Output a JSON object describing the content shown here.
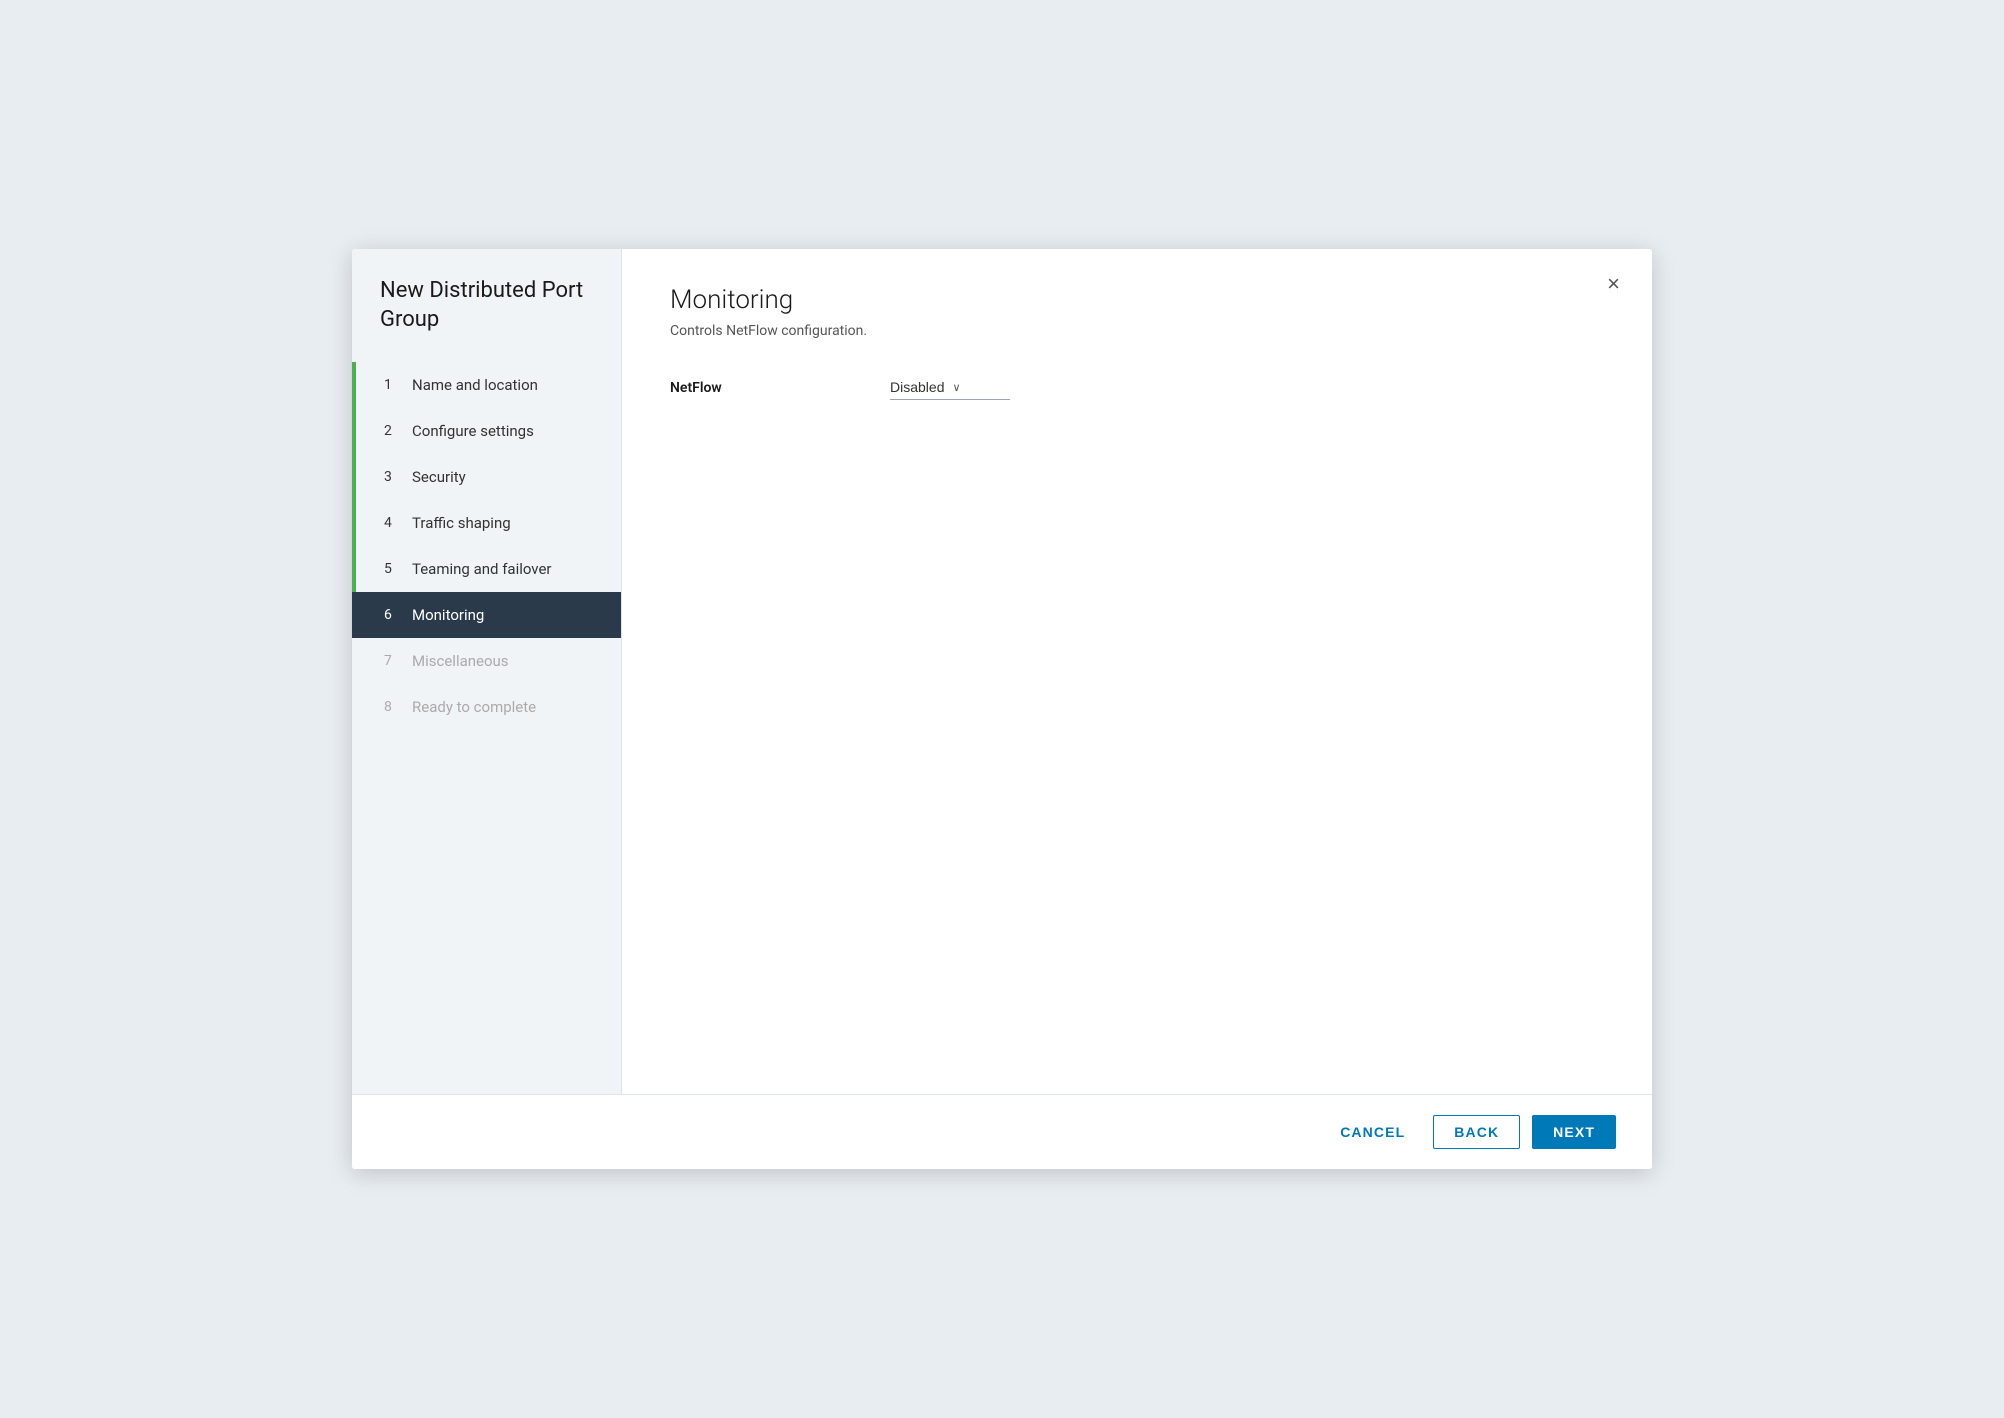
{
  "dialog": {
    "title": "New Distributed Port Group",
    "close_label": "×"
  },
  "sidebar": {
    "title": "New Distributed Port Group",
    "items": [
      {
        "num": "1",
        "label": "Name and location",
        "state": "completed"
      },
      {
        "num": "2",
        "label": "Configure settings",
        "state": "completed"
      },
      {
        "num": "3",
        "label": "Security",
        "state": "completed"
      },
      {
        "num": "4",
        "label": "Traffic shaping",
        "state": "completed"
      },
      {
        "num": "5",
        "label": "Teaming and failover",
        "state": "completed"
      },
      {
        "num": "6",
        "label": "Monitoring",
        "state": "active"
      },
      {
        "num": "7",
        "label": "Miscellaneous",
        "state": "disabled"
      },
      {
        "num": "8",
        "label": "Ready to complete",
        "state": "disabled"
      }
    ]
  },
  "main": {
    "page_title": "Monitoring",
    "page_desc": "Controls NetFlow configuration.",
    "form": {
      "netflow_label": "NetFlow",
      "netflow_value": "Disabled",
      "netflow_chevron": "∨"
    }
  },
  "footer": {
    "cancel_label": "CANCEL",
    "back_label": "BACK",
    "next_label": "NEXT"
  }
}
